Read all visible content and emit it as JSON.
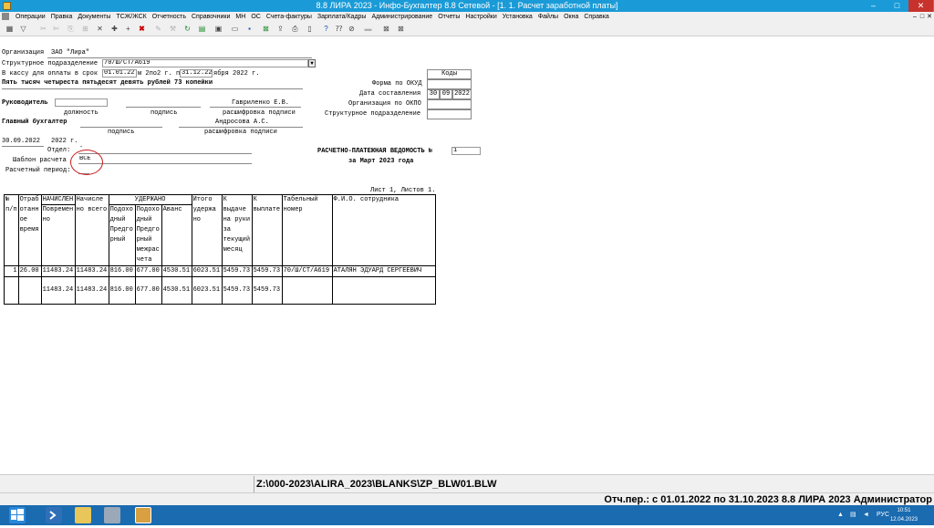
{
  "window": {
    "title": "8.8 ЛИРА 2023 - Инфо-Бухгалтер 8.8 Сетевой - [1. 1. Расчет заработной платы]",
    "min": "–",
    "max": "□",
    "close": "✕"
  },
  "menu": [
    "Операции",
    "Правка",
    "Документы",
    "ТСЖ/ЖСК",
    "Отчетность",
    "Справочники",
    "МН",
    "ОС",
    "Счета-фактуры",
    "Зарплата/Кадры",
    "Администрирование",
    "Отчеты",
    "Настройки",
    "Установка",
    "Файлы",
    "Окна",
    "Справка"
  ],
  "mdi": {
    "min": "–",
    "max": "□",
    "close": "✕"
  },
  "toolbar_icons": [
    "calculator-icon",
    "filter-icon",
    "cut-icon",
    "scissors-icon",
    "copy-icon",
    "paste-icon",
    "multiply-icon",
    "add-icon",
    "delete-icon",
    "edit-icon",
    "tools-icon",
    "undo-icon",
    "refresh-icon",
    "table-icon",
    "book-icon",
    "folder-open-icon",
    "save-icon",
    "excel-icon",
    "export-icon",
    "zoom-icon",
    "print-icon",
    "preview-icon",
    "help-icon",
    "help-topic-icon",
    "options-icon",
    "dash-icon",
    "close-doc-icon",
    "close-all-icon"
  ],
  "doc": {
    "org_label": "Организация",
    "org_value": "ЗАО \"Лира\"",
    "subdiv_label": "Структурное подразделение",
    "subdiv_value": "70/Ш/СТ/А619",
    "pay_label": "В кассу для оплаты в срок",
    "pay_from": "01.01.22",
    "pay_mid": "м 2по2 г. п",
    "pay_to": "31.12.22",
    "pay_tail": "ября 2022 г.",
    "sum_words": "Пять тысяч четыреста пятьдесят девять рублей 73 копейки",
    "head_label": "Руководитель",
    "head_position": "должность",
    "head_sign": "подпись",
    "head_name": "Гавриленко Е.В.",
    "head_name_caption": "расшифровка подписи",
    "acc_label": "Главный бухгалтер",
    "acc_sign": "подпись",
    "acc_name": "Андросова А.С.",
    "acc_name_caption": "расшифровка подписи",
    "date_value": "30.09.2022",
    "date_year": "2022 г.",
    "dept_label": "Отдел:",
    "dept_value": "*",
    "template_label": "Шаблон расчета",
    "template_value": "ВСЕ",
    "period_label": "Расчетный период:",
    "codes_header": "Коды",
    "okud_label": "Форма по ОКУД",
    "date_comp_label": "Дата составления",
    "date_comp": [
      "30",
      "09",
      "2022"
    ],
    "okpo_label": "Организация по ОКПО",
    "struct_label": "Структурное подразделение",
    "sheet_title": "РАСЧЕТНО-ПЛАТЕЖНАЯ ВЕДОМОСТЬ №",
    "sheet_number": "1",
    "sheet_period": "за Март 2023 года",
    "pages": "Лист 1, Листов 1."
  },
  "table": {
    "h_num": [
      "№",
      "п/п"
    ],
    "h_time": [
      "Отраб",
      "отанн",
      "ое",
      "время"
    ],
    "h_accr": "НАЧИСЛЕН",
    "h_accr_sub": [
      "Повремен",
      "но"
    ],
    "h_accr_total": [
      "Начисле",
      "но всего"
    ],
    "h_withheld": "УДЕРЖАНО",
    "h_tax1": [
      "Подохо",
      "дный",
      "Предго",
      "рный"
    ],
    "h_tax2": [
      "Подохо",
      "дный",
      "Предго",
      "рный",
      "межрас",
      "чета"
    ],
    "h_advance": "Аванс",
    "h_total_withheld": [
      "Итого",
      "удержа",
      "но"
    ],
    "h_to_pay": [
      "К",
      "выдаче",
      "на руки",
      "за",
      "текущий",
      "месяц"
    ],
    "h_payout": [
      "К",
      "выплате"
    ],
    "h_tab": [
      "Табельный",
      "номер"
    ],
    "h_fio": "Ф.И.О. сотрудника",
    "row": {
      "n": "1",
      "time": "26.00",
      "accr": "11483.24",
      "accr_total": "11483.24",
      "tax1": "816.00",
      "tax2": "677.00",
      "advance": "4530.51",
      "total_w": "6023.51",
      "to_pay": "5459.73",
      "payout": "5459.73",
      "tab": "70/Ш/СТ/А619",
      "fio": "АТАЛЯН ЭДУАРД СЕРГЕЕВИЧ"
    },
    "totals": {
      "accr": "11483.24",
      "accr_total": "11483.24",
      "tax1": "816.00",
      "tax2": "677.00",
      "advance": "4530.51",
      "total_w": "6023.51",
      "to_pay": "5459.73",
      "payout": "5459.73"
    }
  },
  "status": {
    "path": "Z:\\000-2023\\ALIRA_2023\\BLANKS\\ZP_BLW01.BLW",
    "info": "Отч.пер.: с 01.01.2022 по 31.10.2023 8.8 ЛИРА 2023 Администратор"
  },
  "taskbar": {
    "lang": "РУС",
    "time": "10:51",
    "date": "12.04.2023"
  },
  "colors": {
    "titlebar": "#1a9bd7",
    "taskbar": "#1a6bb0",
    "annotation": "#cc1a1a"
  }
}
